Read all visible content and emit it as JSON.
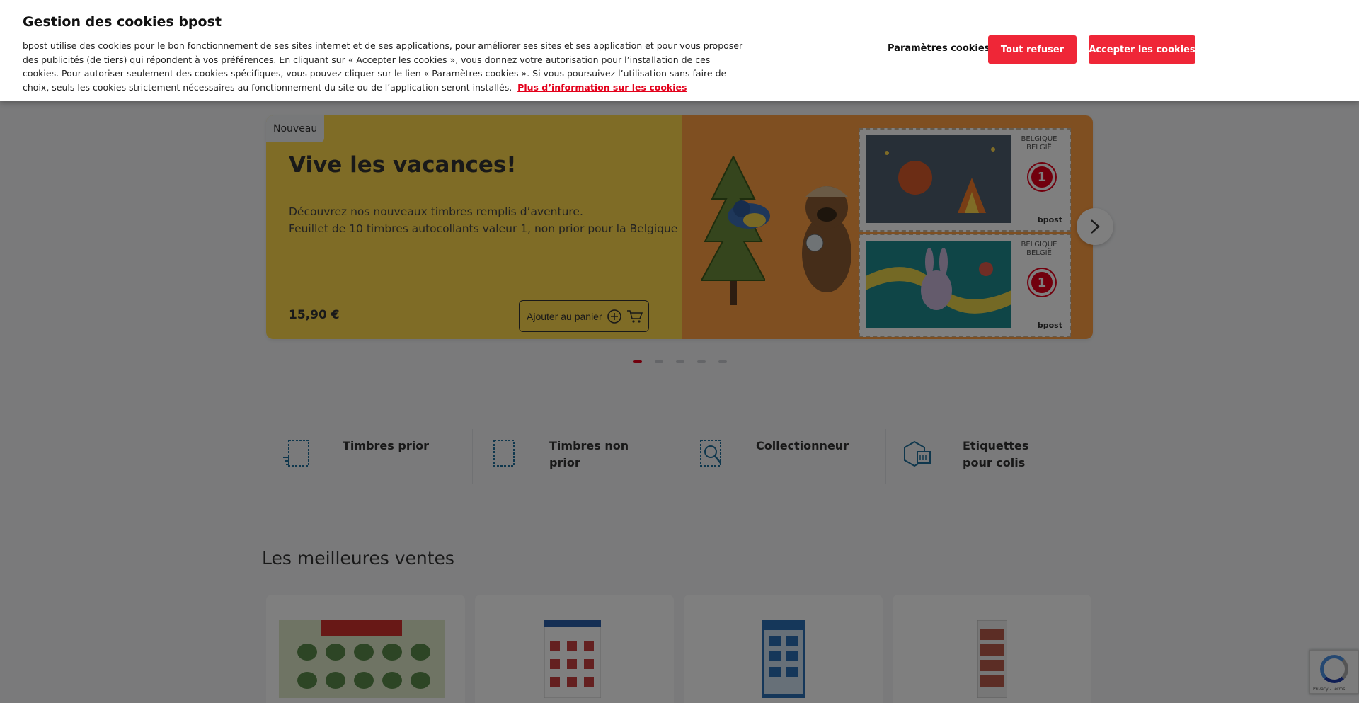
{
  "cookie_banner": {
    "title": "Gestion des cookies bpost",
    "text": "bpost utilise des cookies pour le bon fonctionnement de ses sites internet et de ses applications, pour améliorer ses sites et ses application et pour vous proposer des publicités (de tiers) qui répondent à vos préférences. En cliquant sur « Accepter les cookies », vous donnez votre autorisation pour l’installation de ces cookies. Pour autoriser seulement des cookies spécifiques, vous pouvez cliquer sur le lien « Paramètres cookies ». Si vous poursuivez l’utilisation sans faire de choix, seuls les cookies strictement nécessaires au fonctionnement du site ou de l’application seront installés.",
    "more_info_link": "Plus d’information sur les cookies",
    "settings_label": "Paramètres cookies",
    "refuse_label": "Tout refuser",
    "accept_label": "Accepter les cookies"
  },
  "hero": {
    "badge": "Nouveau",
    "title": "Vive les vacances!",
    "desc_line1": "Découvrez nos nouveaux timbres remplis d’aventure.",
    "desc_line2": "Feuillet de 10 timbres autocollants valeur 1, non prior pour la Belgique",
    "price": "15,90 €",
    "cart_label": "Ajouter au panier",
    "stamp_country_1": "BELGIQUE",
    "stamp_country_2": "BELGIË",
    "stamp_value": "1",
    "stamp_brand": "bpost"
  },
  "carousel": {
    "total": 5,
    "active": 1
  },
  "categories": [
    {
      "label_1": "Timbres prior",
      "label_2": "",
      "icon": "stamp-prior-icon"
    },
    {
      "label_1": "Timbres non",
      "label_2": "prior",
      "icon": "stamp-icon"
    },
    {
      "label_1": "Collectionneur",
      "label_2": "",
      "icon": "magnifier-stamp-icon"
    },
    {
      "label_1": "Etiquettes",
      "label_2": "pour colis",
      "icon": "parcel-label-icon"
    }
  ],
  "best_sellers": {
    "title": "Les meilleures ventes"
  },
  "recaptcha": {
    "links": "Privacy - Terms"
  },
  "colors": {
    "brand_red": "#ef2637",
    "hero_yellow": "#ffd94c",
    "hero_orange": "#ff9e42"
  }
}
